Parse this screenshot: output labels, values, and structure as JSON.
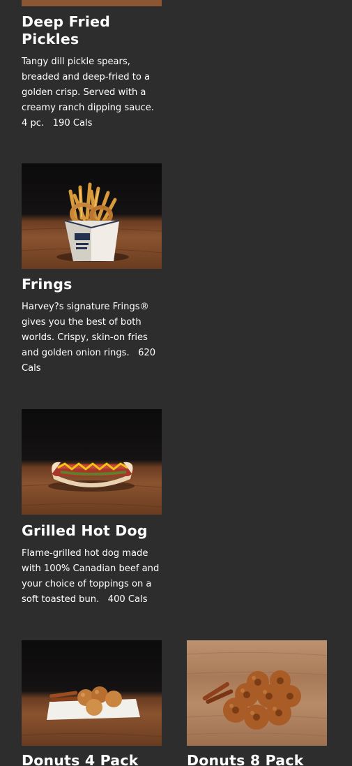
{
  "items": [
    {
      "title": "Deep Fried Pickles",
      "description": "Tangy dill pickle spears, breaded and deep-fried to a golden crisp. Served with a creamy ranch dipping sauce. 4 pc.",
      "calories": "190 Cals"
    },
    {
      "title": "Frings",
      "description": "Harvey?s signature Frings® gives you the best of both worlds. Crispy, skin-on fries and golden onion rings.",
      "calories": "620 Cals"
    },
    {
      "title": "Grilled Hot Dog",
      "description": "Flame-grilled hot dog made with 100% Canadian beef and your choice of toppings on a soft toasted bun.",
      "calories": "400 Cals"
    },
    {
      "title": "Donuts 4 Pack"
    },
    {
      "title": "Donuts 8 Pack"
    }
  ],
  "colors": {
    "background": "#2d2d2d",
    "text": "#ffffff"
  }
}
